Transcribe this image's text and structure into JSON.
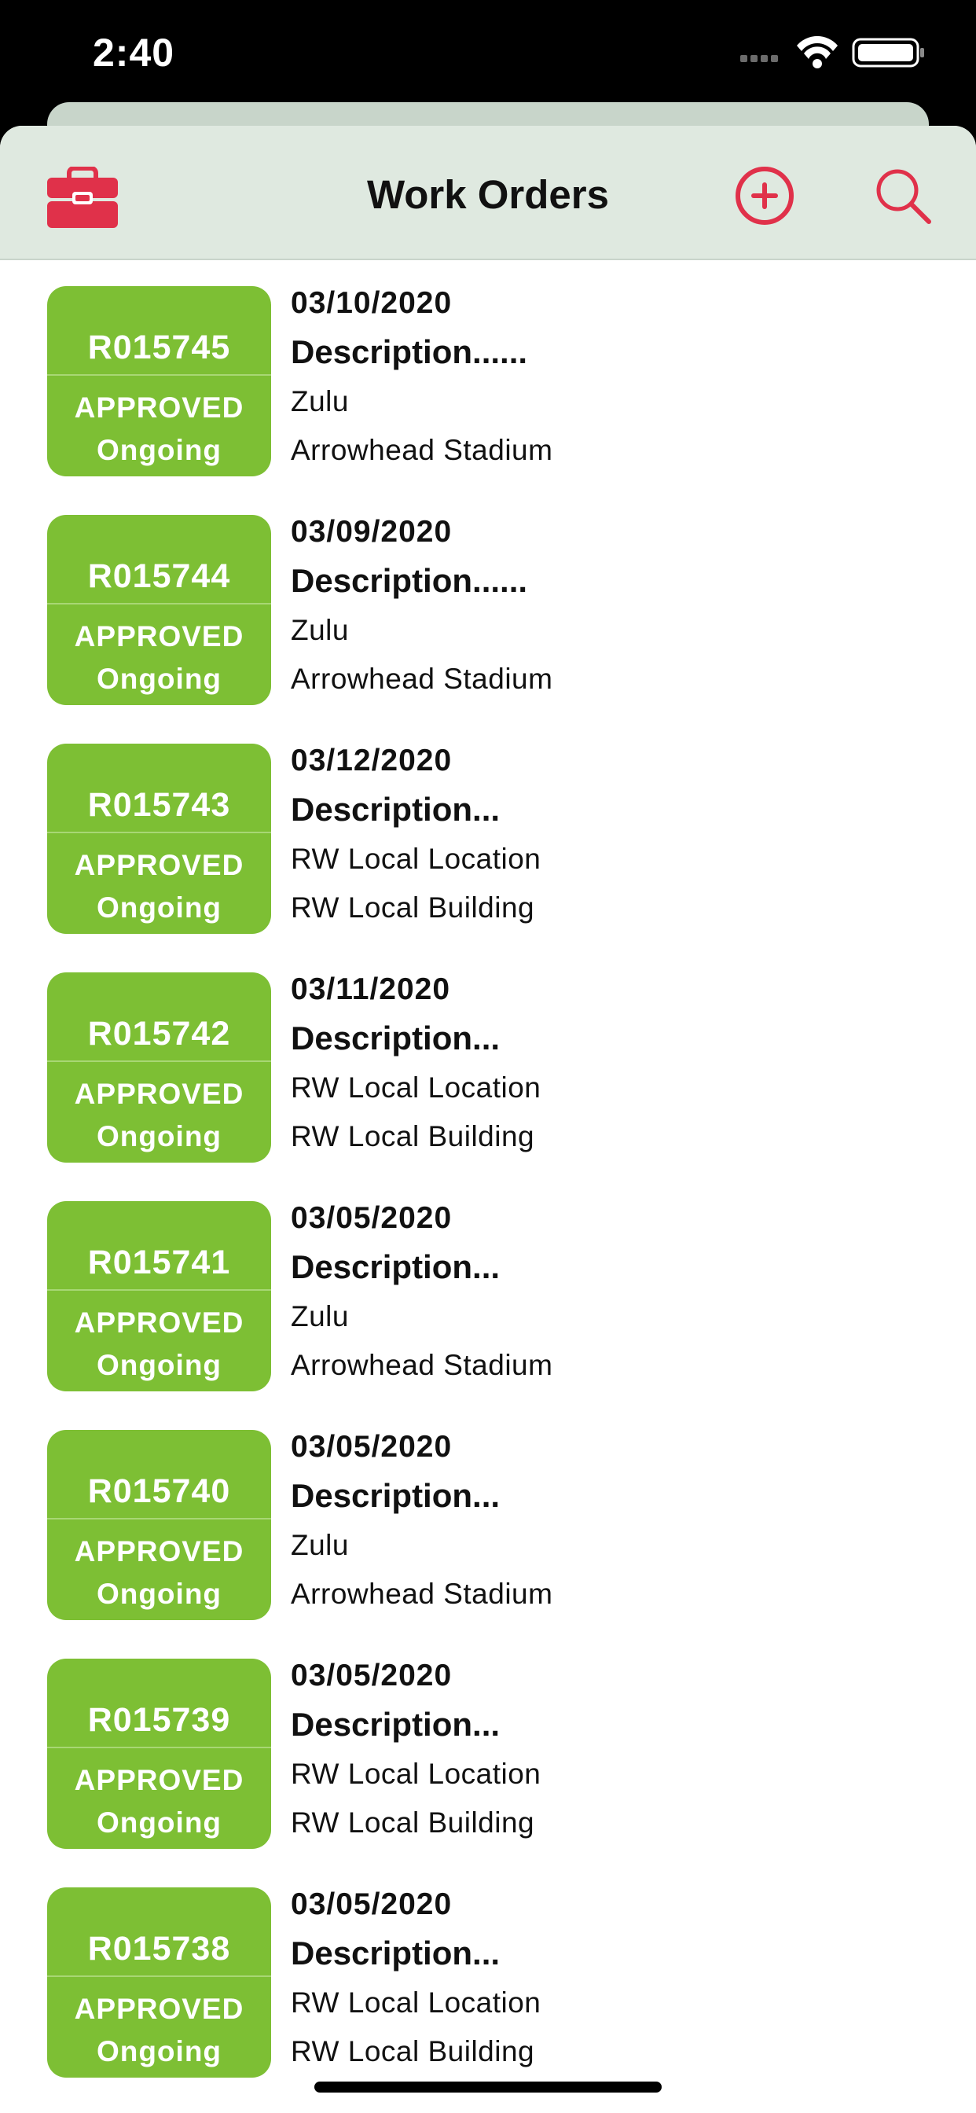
{
  "status_bar": {
    "time": "2:40"
  },
  "nav": {
    "title": "Work Orders",
    "left_icon": "toolbox-icon",
    "right_icons": [
      "add-circle-icon",
      "search-icon"
    ],
    "accent_color": "#e0314a",
    "bar_color": "#dfe9e0"
  },
  "badge_color": "#7dbf34",
  "work_orders": [
    {
      "id": "R015745",
      "status": "APPROVED",
      "phase": "Ongoing",
      "date": "03/10/2020",
      "description": "Description......",
      "location": "Zulu",
      "building": "Arrowhead Stadium"
    },
    {
      "id": "R015744",
      "status": "APPROVED",
      "phase": "Ongoing",
      "date": "03/09/2020",
      "description": "Description......",
      "location": "Zulu",
      "building": "Arrowhead Stadium"
    },
    {
      "id": "R015743",
      "status": "APPROVED",
      "phase": "Ongoing",
      "date": "03/12/2020",
      "description": "Description...",
      "location": "RW Local Location",
      "building": "RW Local Building"
    },
    {
      "id": "R015742",
      "status": "APPROVED",
      "phase": "Ongoing",
      "date": "03/11/2020",
      "description": "Description...",
      "location": "RW Local Location",
      "building": "RW Local Building"
    },
    {
      "id": "R015741",
      "status": "APPROVED",
      "phase": "Ongoing",
      "date": "03/05/2020",
      "description": "Description...",
      "location": "Zulu",
      "building": "Arrowhead Stadium"
    },
    {
      "id": "R015740",
      "status": "APPROVED",
      "phase": "Ongoing",
      "date": "03/05/2020",
      "description": "Description...",
      "location": "Zulu",
      "building": "Arrowhead Stadium"
    },
    {
      "id": "R015739",
      "status": "APPROVED",
      "phase": "Ongoing",
      "date": "03/05/2020",
      "description": "Description...",
      "location": "RW Local Location",
      "building": "RW Local Building"
    },
    {
      "id": "R015738",
      "status": "APPROVED",
      "phase": "Ongoing",
      "date": "03/05/2020",
      "description": "Description...",
      "location": "RW Local Location",
      "building": "RW Local Building"
    }
  ]
}
